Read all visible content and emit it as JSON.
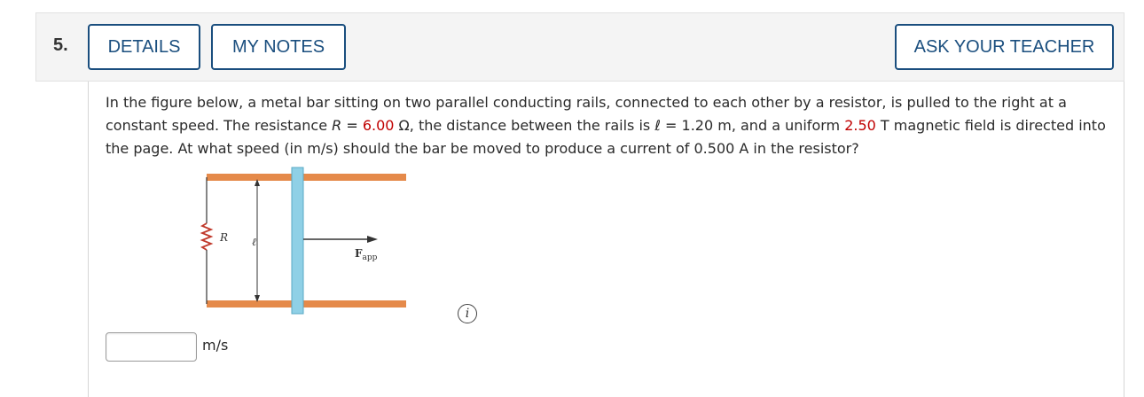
{
  "question": {
    "number": "5.",
    "buttons": {
      "details": "DETAILS",
      "my_notes": "MY NOTES",
      "ask_teacher": "ASK YOUR TEACHER"
    },
    "text": {
      "p1": "In the figure below, a metal bar sitting on two parallel conducting rails, connected to each other by a resistor, is pulled to the right at a constant speed. The resistance ",
      "r_symbol": "R",
      "eq1": " = ",
      "r_value": "6.00",
      "r_unit": " Ω, the distance between the rails is ",
      "l_symbol": "ℓ",
      "eq2": " = 1.20 m, and a uniform ",
      "b_value": "2.50",
      "p2": " T magnetic field is directed into the page. At what speed (in m/s) should the bar be moved to produce a current of 0.500 A in the resistor?"
    },
    "figure": {
      "resistor_label": "R",
      "length_label": "ℓ",
      "force_label_main": "F",
      "force_label_sub": "app"
    },
    "answer": {
      "value": "",
      "unit": "m/s"
    },
    "info_icon_glyph": "i"
  },
  "colors": {
    "link": "#1a4e7e",
    "highlight": "#c00000",
    "rail": "#e58a4a",
    "bar": "#8fd0e6"
  }
}
